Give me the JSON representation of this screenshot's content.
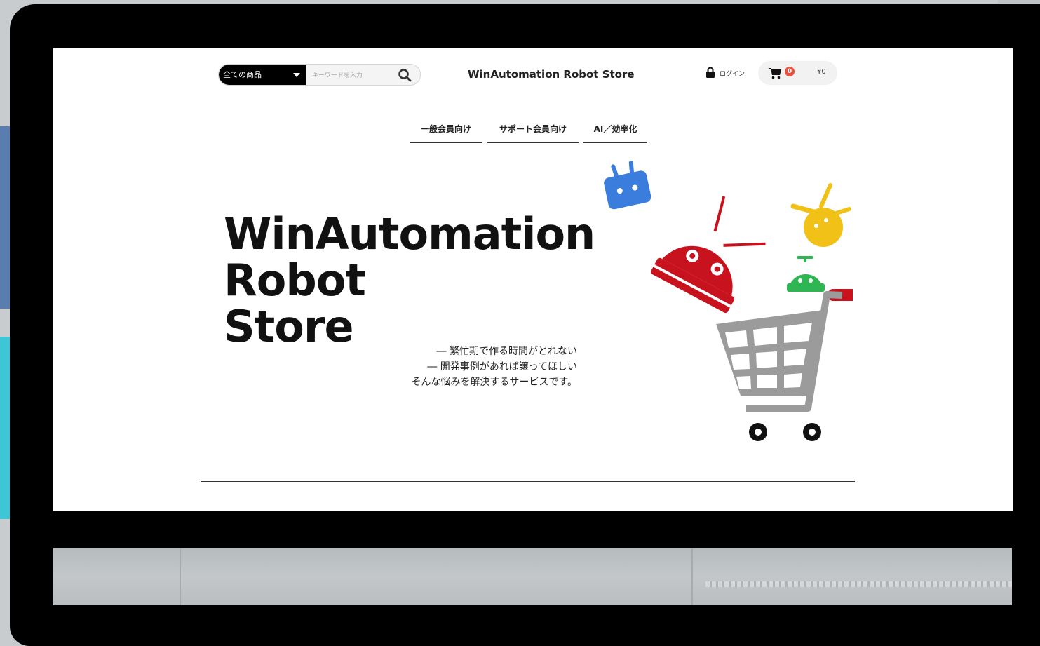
{
  "header": {
    "category_select": "全ての商品",
    "search_placeholder": "キーワードを入力",
    "site_title": "WinAutomation Robot Store",
    "login_label": "ログイン",
    "cart_count": "0",
    "cart_total": "¥0"
  },
  "nav": {
    "items": [
      {
        "label": "一般会員向け"
      },
      {
        "label": "サポート会員向け"
      },
      {
        "label": "AI／効率化"
      }
    ]
  },
  "hero": {
    "title_lines": [
      "WinAutomation",
      "Robot",
      "Store"
    ],
    "tagline_lines": [
      "― 繁忙期で作る時間がとれない",
      "― 開発事例があれば譲ってほしい",
      "そんな悩みを解決するサービスです。"
    ]
  },
  "colors": {
    "robot_blue": "#3b7ddd",
    "robot_red": "#c8121e",
    "robot_yellow": "#f2c117",
    "robot_green": "#2fb552",
    "cart_gray": "#9b9b9b",
    "badge_red": "#e8503f"
  },
  "icons": {
    "search": "search-icon",
    "lock": "lock-icon",
    "cart": "shopping-cart-icon"
  }
}
